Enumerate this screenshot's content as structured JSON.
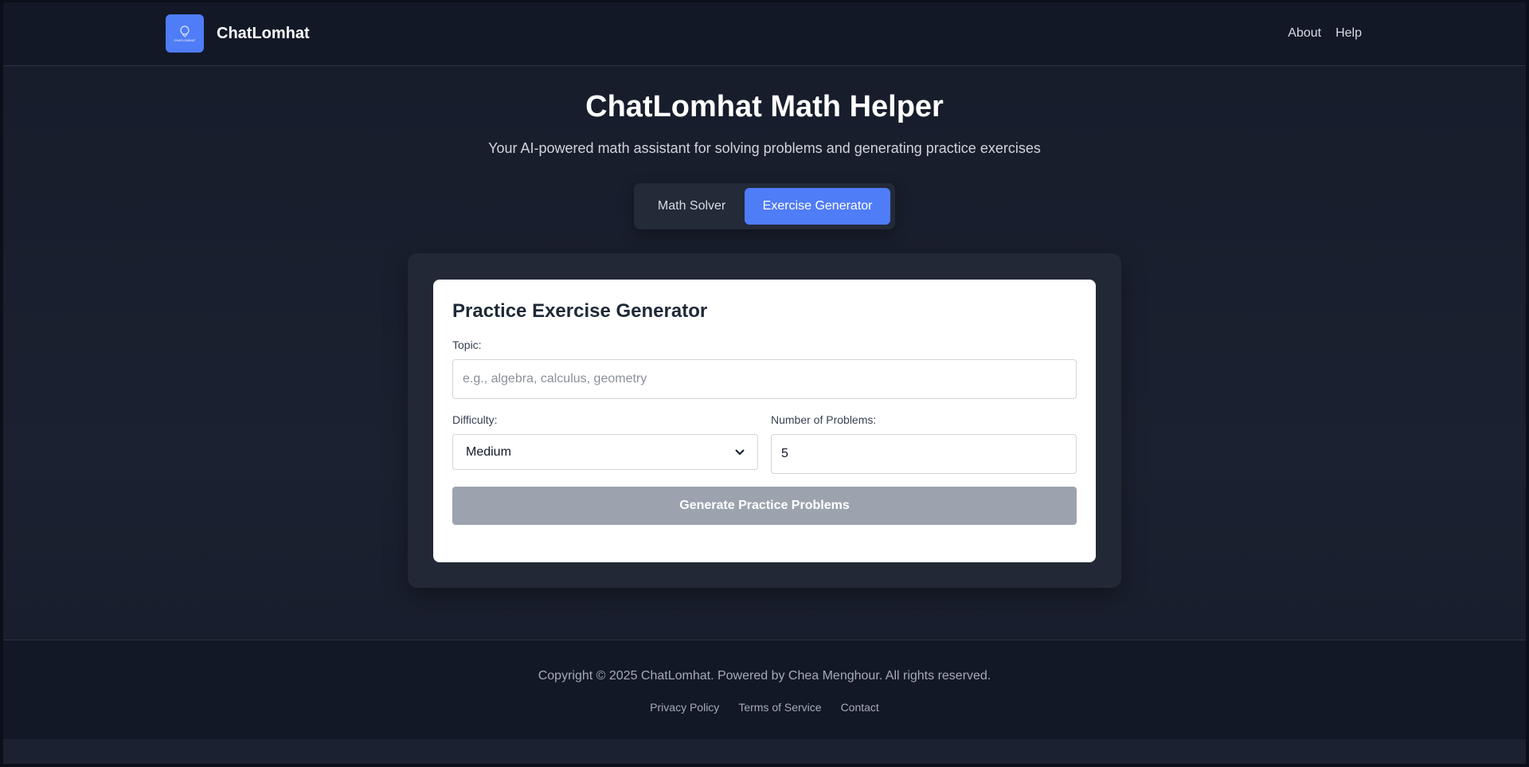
{
  "header": {
    "brand": "ChatLomhat",
    "logo_icon": "brain-icon",
    "logo_text": "CHATLOMHAT",
    "nav": [
      {
        "label": "About"
      },
      {
        "label": "Help"
      }
    ]
  },
  "hero": {
    "title": "ChatLomhat Math Helper",
    "subtitle": "Your AI-powered math assistant for solving problems and generating practice exercises"
  },
  "tabs": [
    {
      "label": "Math Solver",
      "active": false
    },
    {
      "label": "Exercise Generator",
      "active": true
    }
  ],
  "form": {
    "title": "Practice Exercise Generator",
    "topic_label": "Topic:",
    "topic_placeholder": "e.g., algebra, calculus, geometry",
    "topic_value": "",
    "difficulty_label": "Difficulty:",
    "difficulty_value": "Medium",
    "count_label": "Number of Problems:",
    "count_value": "5",
    "submit_label": "Generate Practice Problems"
  },
  "footer": {
    "copyright": "Copyright © 2025 ChatLomhat. Powered by Chea Menghour. All rights reserved.",
    "links": [
      {
        "label": "Privacy Policy"
      },
      {
        "label": "Terms of Service"
      },
      {
        "label": "Contact"
      }
    ]
  },
  "colors": {
    "accent": "#4f7cf7",
    "header_bg": "#121826",
    "page_bg": "#1b2130",
    "button_disabled": "#9ca3af"
  }
}
